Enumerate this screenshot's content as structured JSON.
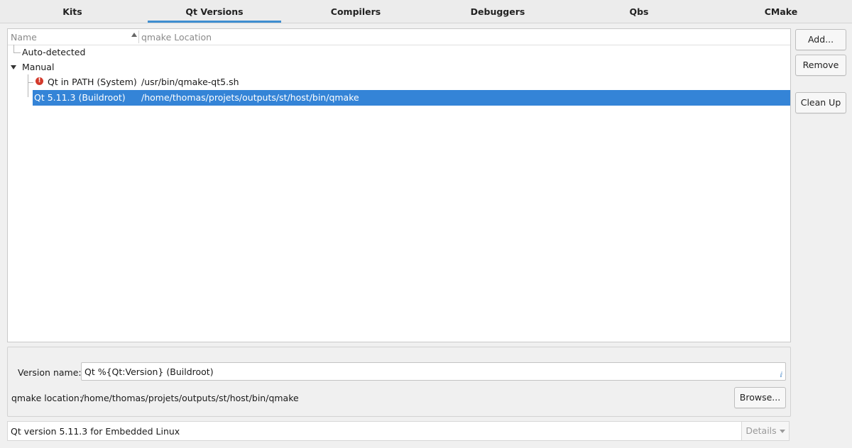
{
  "tabs": [
    {
      "label": "Kits"
    },
    {
      "label": "Qt Versions"
    },
    {
      "label": "Compilers"
    },
    {
      "label": "Debuggers"
    },
    {
      "label": "Qbs"
    },
    {
      "label": "CMake"
    }
  ],
  "active_tab": "Qt Versions",
  "tree": {
    "columns": {
      "name": "Name",
      "path": "qmake Location"
    },
    "auto_detected": "Auto-detected",
    "manual": "Manual",
    "items": [
      {
        "name": "Qt  in PATH (System)",
        "path": "/usr/bin/qmake-qt5.sh",
        "status_icon": "error-icon"
      },
      {
        "name": "Qt 5.11.3 (Buildroot)",
        "path": "/home/thomas/projets/outputs/st/host/bin/qmake",
        "selected": true
      }
    ]
  },
  "buttons": {
    "add": "Add...",
    "remove": "Remove",
    "cleanup": "Clean Up"
  },
  "details": {
    "version_name_label": "Version name:",
    "version_name_value": "Qt %{Qt:Version} (Buildroot)",
    "qmake_location_label": "qmake location:",
    "qmake_location_value": "/home/thomas/projets/outputs/st/host/bin/qmake",
    "browse": "Browse..."
  },
  "summary": {
    "text": "Qt version 5.11.3 for Embedded Linux",
    "details_button": "Details"
  },
  "colors": {
    "accent": "#3484d7",
    "error": "#d33a2c"
  }
}
